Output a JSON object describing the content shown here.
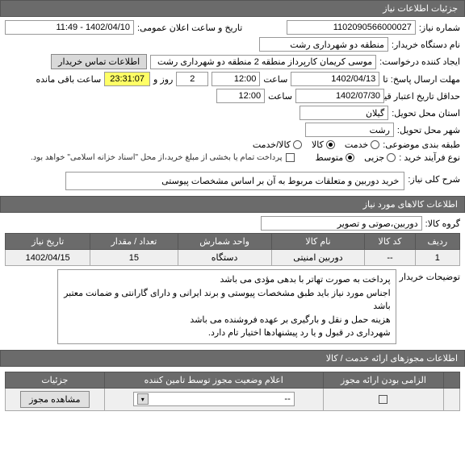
{
  "headers": {
    "main": "جزئیات اطلاعات نیاز",
    "goods": "اطلاعات کالاهای مورد نیاز",
    "permits": "اطلاعات مجوزهای ارائه خدمت / کالا"
  },
  "form": {
    "need_no_label": "شماره نیاز:",
    "need_no": "1102090566000027",
    "announce_label": "تاریخ و ساعت اعلان عمومی:",
    "announce": "1402/04/10 - 11:49",
    "buyer_org_label": "نام دستگاه خریدار:",
    "buyer_org": "منطقه دو شهرداری رشت",
    "creator_label": "ایجاد کننده درخواست:",
    "creator": "موسی کریمان کارپرداز منطقه 2 منطقه دو شهرداری رشت",
    "contact_btn": "اطلاعات تماس خریدار",
    "deadline_label": "مهلت ارسال پاسخ: تا",
    "deadline_date": "1402/04/13",
    "time_label": "ساعت",
    "deadline_time": "12:00",
    "days_val": "2",
    "days_label": "روز و",
    "countdown": "23:31:07",
    "remain_label": "ساعت باقی مانده",
    "min_validity_label": "حداقل تاریخ اعتبار قیمت: تا تاریخ:",
    "min_validity_date": "1402/07/30",
    "min_validity_time": "12:00",
    "province_label": "استان محل تحویل:",
    "province": "گیلان",
    "city_label": "شهر محل تحویل:",
    "city": "رشت",
    "topic_class_label": "طبقه بندی موضوعی:",
    "topic_opt_service": "خدمت",
    "topic_opt_goods": "کالا",
    "topic_opt_both": "کالا/خدمت",
    "process_label": "نوع فرآیند خرید :",
    "process_opt_small": "جزیی",
    "process_opt_medium": "متوسط",
    "payment_note": "پرداخت تمام یا بخشی از مبلغ خرید،از محل \"اسناد خزانه اسلامی\" خواهد بود.",
    "summary_label": "شرح کلی نیاز:",
    "summary": "خرید دوربین و متعلقات مربوط به آن بر اساس مشخصات پیوستی",
    "group_label": "گروه کالا:",
    "group": "دوربین،صوتی و تصویر",
    "notes_label": "توضیحات خریدار",
    "notes_line1": "پرداخت به صورت تهاتر با بدهی مؤدی می باشد",
    "notes_line2": "اجناس مورد نیاز باید طبق مشخصات پیوستی و برند ایرانی و دارای گارانتی و ضمانت معتبر باشد",
    "notes_line3": "هزینه حمل و نقل و بارگیری بر عهده فروشنده می باشد",
    "notes_line4": "شهرداری در قبول و یا رد پیشنهادها اختیار تام دارد."
  },
  "goods_table": {
    "cols": {
      "row": "ردیف",
      "code": "کد کالا",
      "name": "نام کالا",
      "unit": "واحد شمارش",
      "qty": "تعداد / مقدار",
      "date": "تاریخ نیاز"
    },
    "rows": [
      {
        "row": "1",
        "code": "--",
        "name": "دوربین امنیتی",
        "unit": "دستگاه",
        "qty": "15",
        "date": "1402/04/15"
      }
    ]
  },
  "permits_table": {
    "cols": {
      "c0": "",
      "c1": "الزامی بودن ارائه مجوز",
      "c2": "اعلام وضعیت مجوز توسط تامین کننده",
      "c3": "جزئیات"
    },
    "row": {
      "sel": "--",
      "btn": "مشاهده مجوز"
    }
  }
}
